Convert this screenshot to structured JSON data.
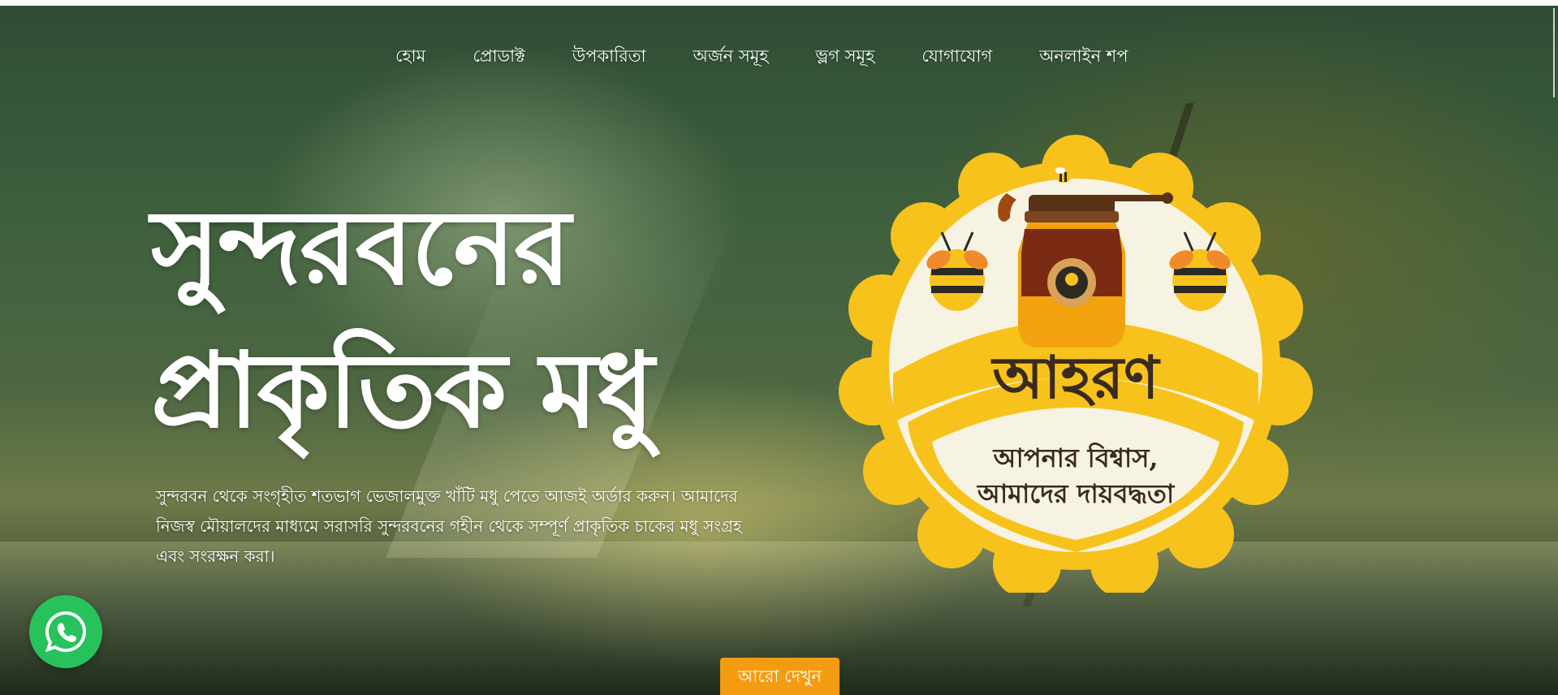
{
  "nav": {
    "items": [
      {
        "label": "হোম"
      },
      {
        "label": "প্রোডাক্ট"
      },
      {
        "label": "উপকারিতা"
      },
      {
        "label": "অর্জন সমূহ"
      },
      {
        "label": "ভ্লগ সমূহ"
      },
      {
        "label": "যোগাযোগ"
      },
      {
        "label": "অনলাইন শপ"
      }
    ]
  },
  "hero": {
    "headline_line1": "সুন্দরবনের",
    "headline_line2": "প্রাকৃতিক মধু",
    "description": "সুন্দরবন থেকে সংগৃহীত শতভাগ ভেজালমুক্ত খাঁটি মধু পেতে আজই অর্ডার করুন। আমাদের নিজস্ব মৌয়ালদের মাধ্যমে সরাসরি সুন্দরবনের গহীন থেকে সম্পূর্ণ প্রাকৃতিক চাকের মধু সংগ্রহ এবং সংরক্ষন করা।",
    "more_button": "আরো দেখুন"
  },
  "badge": {
    "brand": "আহরণ",
    "tagline_line1": "আপনার বিশ্বাস,",
    "tagline_line2": "আমাদের দায়বদ্ধতা"
  },
  "icons": {
    "whatsapp": "whatsapp-icon",
    "honey_jar": "honey-jar-icon",
    "bee": "bee-icon"
  },
  "colors": {
    "accent": "#f39c12",
    "badge_yellow": "#f7c21b",
    "badge_cream": "#f7f3e2",
    "brand_text": "#3a2a1e",
    "whatsapp_green": "#27c25c"
  }
}
